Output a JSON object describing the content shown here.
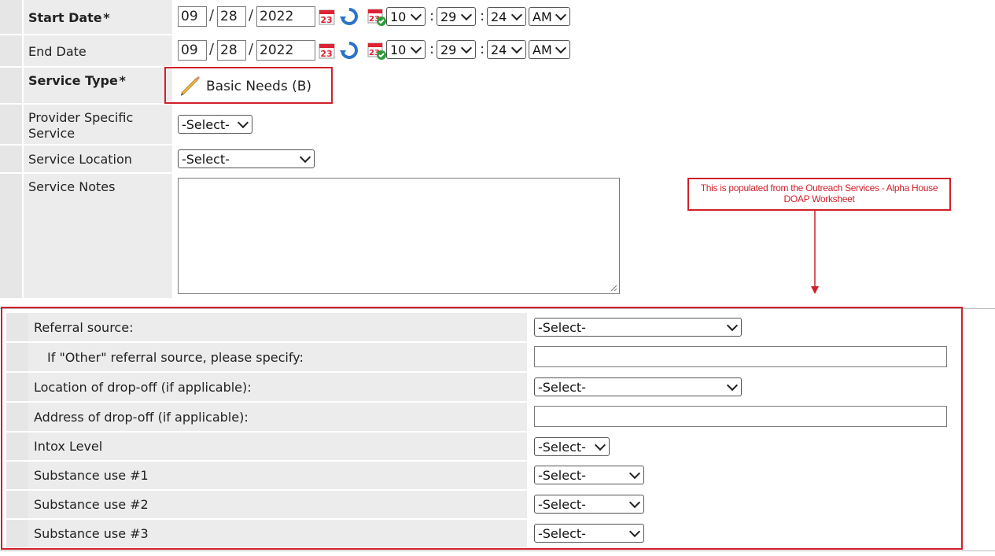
{
  "start_date": {
    "label": "Start Date",
    "required_mark": "*",
    "month": "09",
    "day": "28",
    "year": "2022",
    "hour": "10",
    "minute": "29",
    "second": "24",
    "ampm": "AM"
  },
  "end_date": {
    "label": "End Date",
    "month": "09",
    "day": "28",
    "year": "2022",
    "hour": "10",
    "minute": "29",
    "second": "24",
    "ampm": "AM"
  },
  "date_sep": "/",
  "time_sep": ":",
  "service_type": {
    "label": "Service Type",
    "required_mark": "*",
    "value": "Basic Needs (B)"
  },
  "provider_specific_service": {
    "label": "Provider Specific Service",
    "value": "-Select-"
  },
  "service_location": {
    "label": "Service Location",
    "value": "-Select-"
  },
  "service_notes": {
    "label": "Service Notes",
    "value": ""
  },
  "annotation": {
    "text": "This is populated from the Outreach Services - Alpha House DOAP Worksheet",
    "color": "#d0202a"
  },
  "worksheet": {
    "referral_source": {
      "label": "Referral source:",
      "value": "-Select-"
    },
    "other_referral": {
      "label": "If \"Other\" referral source, please specify:",
      "value": ""
    },
    "dropoff_location": {
      "label": "Location of drop-off (if applicable):",
      "value": "-Select-"
    },
    "dropoff_address": {
      "label": "Address of drop-off (if applicable):",
      "value": ""
    },
    "intox_level": {
      "label": "Intox Level",
      "value": "-Select-"
    },
    "substance_1": {
      "label": "Substance use #1",
      "value": "-Select-"
    },
    "substance_2": {
      "label": "Substance use #2",
      "value": "-Select-"
    },
    "substance_3": {
      "label": "Substance use #3",
      "value": "-Select-"
    }
  },
  "icons": [
    "calendar-icon",
    "refresh-icon",
    "calendar-check-icon",
    "pencil-icon"
  ]
}
